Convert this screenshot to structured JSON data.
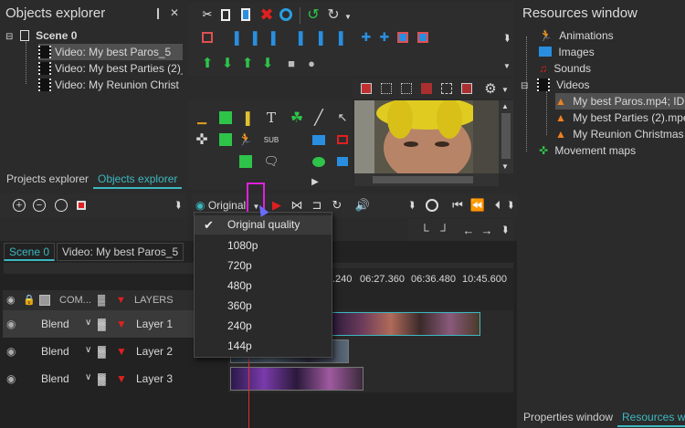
{
  "objects_explorer": {
    "title": "Objects explorer",
    "pin_glyph": "📌",
    "close_glyph": "✕",
    "scene": "Scene 0",
    "items": [
      "Video: My best Paros_5",
      "Video: My best Parties (2)_",
      "Video: My Reunion Christ"
    ],
    "tabs": [
      "Projects explorer",
      "Objects explorer"
    ]
  },
  "resources_window": {
    "title": "Resources window",
    "tree": [
      {
        "label": "Animations",
        "icon": "animation-icon"
      },
      {
        "label": "Images",
        "icon": "image-icon"
      },
      {
        "label": "Sounds",
        "icon": "music-icon"
      },
      {
        "label": "Videos",
        "icon": "video-folder-icon"
      },
      {
        "label": "My best Paros.mp4; ID",
        "icon": "vlc-icon"
      },
      {
        "label": "My best Parties (2).mpe",
        "icon": "vlc-icon"
      },
      {
        "label": "My Reunion Christmas",
        "icon": "vlc-icon"
      },
      {
        "label": "Movement maps",
        "icon": "movement-icon"
      }
    ],
    "tabs": [
      "Properties window",
      "Resources wi"
    ]
  },
  "playback": {
    "quality_label": "Original",
    "quality_options": [
      "Original quality",
      "1080p",
      "720p",
      "480p",
      "360p",
      "240p",
      "144p"
    ],
    "selected_quality": "Original quality"
  },
  "timeline": {
    "tabs": [
      "Scene 0",
      "Video: My best Paros_5"
    ],
    "ruler_labels": [
      ".240",
      "06:27.360",
      "06:36.480",
      "10:45.600"
    ],
    "columns": {
      "com": "COM...",
      "layers": "LAYERS"
    },
    "layers": [
      {
        "blend": "Blend",
        "name": "Layer 1"
      },
      {
        "blend": "Blend",
        "name": "Layer 2"
      },
      {
        "blend": "Blend",
        "name": "Layer 3"
      }
    ]
  },
  "colors": {
    "accent": "#3db8c0",
    "highlight": "#e020e0",
    "playhead": "#e03030",
    "green": "#2ec44a",
    "blue": "#2a8ee0"
  }
}
